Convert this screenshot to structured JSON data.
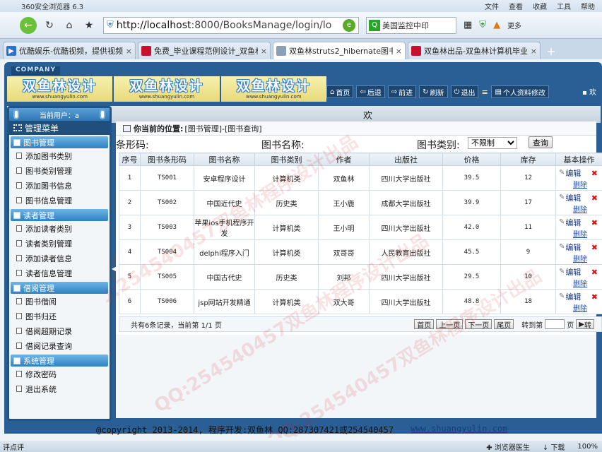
{
  "browser": {
    "app_title": "360安全浏览器 6.3",
    "menus": [
      "文件",
      "查看",
      "收藏",
      "工具",
      "帮助"
    ],
    "url_host": "http://localhost",
    "url_path": ":8000/BooksManage/login/lo",
    "search_text": "美国监控中印",
    "more_label": "更多",
    "tabs": [
      {
        "label": "优酷娱乐-优酷视频，提供视频",
        "icon": "play-icon",
        "color": "#2f6fd1",
        "active": false
      },
      {
        "label": "免费_毕业课程范例设计_双鱼林",
        "icon": "logo-icon",
        "color": "#c8102e",
        "active": false
      },
      {
        "label": "双鱼林struts2_hibernate图书",
        "icon": "page-icon",
        "color": "#8aa0b8",
        "active": true
      },
      {
        "label": "双鱼林出品-双鱼林计算机毕业",
        "icon": "logo-icon",
        "color": "#c8102e",
        "active": false
      }
    ]
  },
  "site": {
    "company": "COMPANY",
    "logo_cn": "双鱼林设计",
    "logo_en": "www.shuangyulin.com",
    "nav": [
      {
        "label": "首页",
        "icon": "home-icon"
      },
      {
        "label": "后退",
        "icon": "back-icon"
      },
      {
        "label": "前进",
        "icon": "forward-icon"
      },
      {
        "label": "刷新",
        "icon": "refresh-icon"
      },
      {
        "label": "退出",
        "icon": "power-icon"
      },
      {
        "label": "个人资料修改",
        "icon": "profile-icon"
      }
    ],
    "welcome": "欢",
    "greeting": "欢"
  },
  "sidebar": {
    "current_user": "当前用户：a",
    "menu_title": "管理菜单",
    "groups": [
      {
        "title": "图书管理",
        "items": [
          "添加图书类别",
          "图书类别管理",
          "添加图书信息",
          "图书信息管理"
        ]
      },
      {
        "title": "读者管理",
        "items": [
          "添加读者类别",
          "读者类别管理",
          "添加读者信息",
          "读者信息管理"
        ]
      },
      {
        "title": "借阅管理",
        "items": [
          "图书借阅",
          "图书归还",
          "借阅超期记录",
          "借阅记录查询"
        ]
      },
      {
        "title": "系统管理",
        "items": [
          "修改密码",
          "退出系统"
        ]
      }
    ]
  },
  "content": {
    "crumb_label": "你当前的位置:",
    "crumb_path": "[图书管理]-[图书查询]",
    "search": {
      "barcode_label": "条形码:",
      "name_label": "图书名称:",
      "type_label": "图书类别:",
      "type_value": "不限制",
      "query_button": "查询"
    },
    "columns": [
      "序号",
      "图书条形码",
      "图书名称",
      "图书类别",
      "作者",
      "出版社",
      "价格",
      "库存",
      "基本操作"
    ],
    "rows": [
      [
        "1",
        "TS001",
        "安卓程序设计",
        "计算机类",
        "双鱼林",
        "四川大学出版社",
        "39.5",
        "12"
      ],
      [
        "2",
        "TS002",
        "中国近代史",
        "历史类",
        "王小鹿",
        "成都大学出版社",
        "39.9",
        "17"
      ],
      [
        "3",
        "TS003",
        "苹果ios手机程序开发",
        "计算机类",
        "王小明",
        "四川大学出版社",
        "42.0",
        "11"
      ],
      [
        "4",
        "TS004",
        "delphi程序入门",
        "计算机类",
        "双哥哥",
        "人民教育出版社",
        "45.5",
        "9"
      ],
      [
        "5",
        "TS005",
        "中国古代史",
        "历史类",
        "刘邦",
        "四川大学出版社",
        "29.5",
        "10"
      ],
      [
        "6",
        "TS006",
        "jsp网站开发精通",
        "计算机类",
        "双大哥",
        "四川大学出版社",
        "48.8",
        "18"
      ]
    ],
    "op_edit": "编辑",
    "op_delete": "删除",
    "pager": {
      "info": "共有6条记录，当前第 1/1 页",
      "first": "首页",
      "prev": "上一页",
      "next": "下一页",
      "last": "尾页",
      "goto_label": "转到第",
      "page_unit": "页",
      "go": "转"
    }
  },
  "footer": {
    "copyright": "@copyright 2013-2014, 程序开发:双鱼林  QQ:287307421或254540457",
    "site": "www.shuangyulin.com"
  },
  "status": {
    "left": "评点评",
    "doctor": "浏览器医生",
    "download": "下载",
    "zoom": "100%"
  },
  "watermark": "QQ:254540457双鱼林程序设计出品"
}
